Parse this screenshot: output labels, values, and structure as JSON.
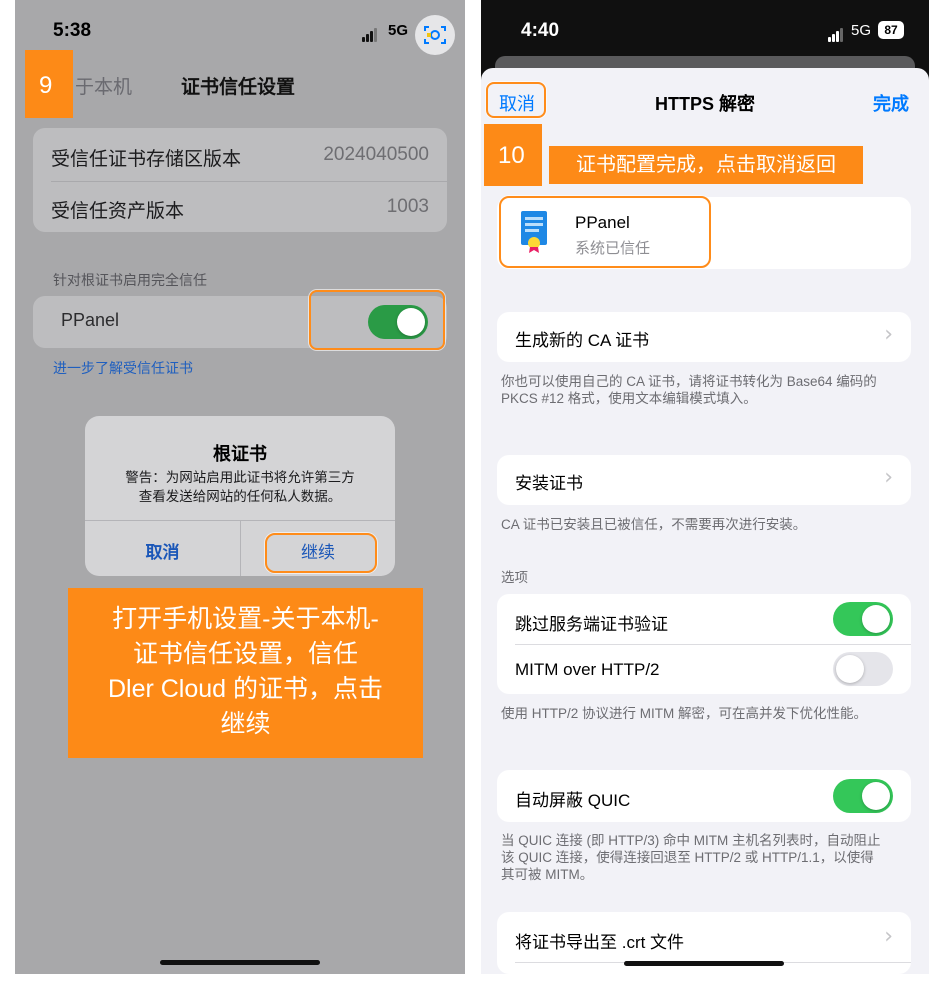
{
  "left": {
    "status": {
      "time": "5:38",
      "network": "5G"
    },
    "badge_number": "9",
    "back_label": "于本机",
    "nav_title": "证书信任设置",
    "rows": [
      {
        "label": "受信任证书存储区版本",
        "value": "2024040500"
      },
      {
        "label": "受信任资产版本",
        "value": "1003"
      }
    ],
    "section_header": "针对根证书启用完全信任",
    "cert_row_label": "PPanel",
    "cert_toggle_on": true,
    "learn_more_link": "进一步了解受信任证书",
    "alert": {
      "title": "根证书",
      "message_line1": "警告：为网站启用此证书将允许第三方",
      "message_line2": "查看发送给网站的任何私人数据。",
      "cancel": "取消",
      "continue": "继续"
    },
    "callout": {
      "line1": "打开手机设置-关于本机-",
      "line2": "证书信任设置，信任",
      "line3": "Dler Cloud 的证书，点击",
      "line4": "继续"
    }
  },
  "right": {
    "status": {
      "time": "4:40",
      "network": "5G",
      "battery": "87"
    },
    "nav": {
      "cancel": "取消",
      "title": "HTTPS 解密",
      "done": "完成"
    },
    "badge_number": "10",
    "callout": "证书配置完成，点击取消返回",
    "cert": {
      "name": "PPanel",
      "status": "系统已信任"
    },
    "generate_ca": "生成新的 CA 证书",
    "generate_ca_footer": "你也可以使用自己的 CA 证书，请将证书转化为 Base64 编码的 PKCS #12 格式，使用文本编辑模式填入。",
    "install_cert": "安装证书",
    "install_cert_footer": "CA 证书已安装且已被信任，不需要再次进行安装。",
    "options_header": "选项",
    "skip_verify": {
      "label": "跳过服务端证书验证",
      "on": true
    },
    "mitm_http2": {
      "label": "MITM over HTTP/2",
      "on": false
    },
    "mitm_http2_footer": "使用 HTTP/2 协议进行 MITM 解密，可在高并发下优化性能。",
    "block_quic": {
      "label": "自动屏蔽 QUIC",
      "on": true
    },
    "block_quic_footer": "当 QUIC 连接 (即 HTTP/3) 命中 MITM 主机名列表时，自动阻止该 QUIC 连接，使得连接回退至 HTTP/2 或 HTTP/1.1，以使得其可被 MITM。",
    "export_cert": "将证书导出至 .crt 文件"
  },
  "colors": {
    "accent_orange": "#fd8a17",
    "ios_blue": "#007aff",
    "ios_green": "#34c759"
  }
}
